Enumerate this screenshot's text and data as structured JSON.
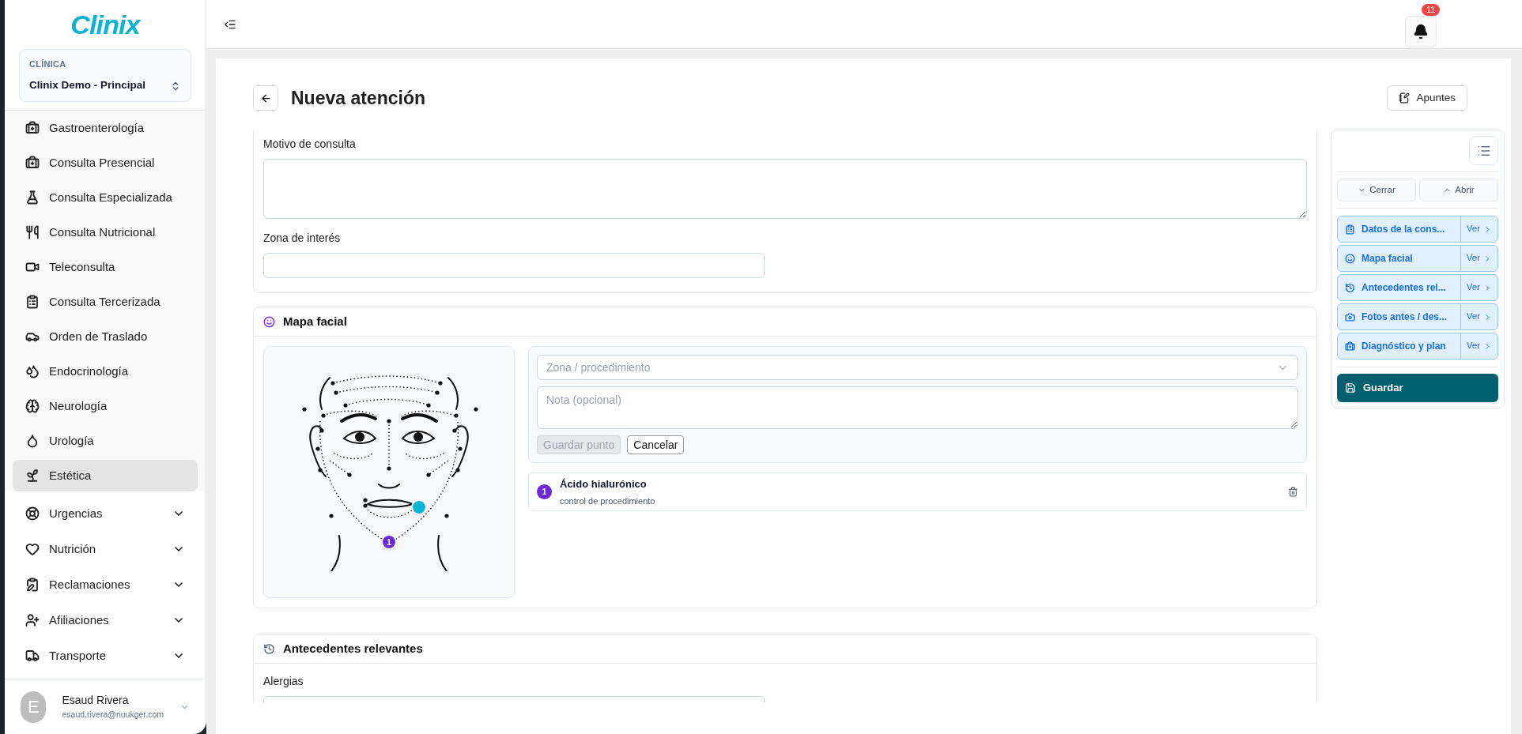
{
  "brand": {
    "logo": "Clinix"
  },
  "clinic": {
    "label": "CLÍNICA",
    "value": "Clinix Demo - Principal"
  },
  "sidebar": {
    "items": [
      {
        "kind": "link",
        "label": "Gastroenterología",
        "selected": false
      },
      {
        "kind": "link",
        "label": "Consulta Presencial",
        "selected": false
      },
      {
        "kind": "link",
        "label": "Consulta Especializada",
        "selected": false
      },
      {
        "kind": "link",
        "label": "Consulta Nutricional",
        "selected": false
      },
      {
        "kind": "link",
        "label": "Teleconsulta",
        "selected": false
      },
      {
        "kind": "link",
        "label": "Consulta Tercerizada",
        "selected": false
      },
      {
        "kind": "link",
        "label": "Orden de Traslado",
        "selected": false
      },
      {
        "kind": "link",
        "label": "Endocrinología",
        "selected": false
      },
      {
        "kind": "link",
        "label": "Neurología",
        "selected": false
      },
      {
        "kind": "link",
        "label": "Urología",
        "selected": false
      },
      {
        "kind": "link",
        "label": "Estética",
        "selected": true
      },
      {
        "kind": "group",
        "label": "Urgencias",
        "selected": false,
        "expanded": false
      },
      {
        "kind": "group",
        "label": "Nutrición",
        "selected": false,
        "expanded": false
      },
      {
        "kind": "group",
        "label": "Reclamaciones",
        "selected": false,
        "expanded": false
      },
      {
        "kind": "group",
        "label": "Afiliaciones",
        "selected": false,
        "expanded": false
      },
      {
        "kind": "group",
        "label": "Transporte",
        "selected": false,
        "expanded": false
      }
    ]
  },
  "user": {
    "initial": "E",
    "name": "Esaud Rivera",
    "email": "esaud.rivera@nuukger.com"
  },
  "header": {
    "notification_count": "11"
  },
  "page": {
    "title": "Nueva atención",
    "notes_button": "Apuntes"
  },
  "consultation": {
    "reason_label": "Motivo de consulta",
    "zone_label": "Zona de interés"
  },
  "facial_map": {
    "title": "Mapa facial",
    "markers": [
      {
        "kind": "pending"
      },
      {
        "kind": "point",
        "label": "1"
      }
    ],
    "zone_select": {
      "placeholder": "Zona / procedimiento"
    },
    "note": {
      "placeholder": "Nota (opcional)"
    },
    "save_button": {
      "label": "Guardar punto",
      "disabled": true
    },
    "cancel_button": "Cancelar",
    "points": [
      {
        "number": "1",
        "title": "Ácido hialurónico",
        "note": "control de procedimiento"
      }
    ]
  },
  "history": {
    "title": "Antecedentes relevantes",
    "allergies_label": "Alergias"
  },
  "outline": {
    "collapse": "Cerrar",
    "expand": "Abrir",
    "items": [
      {
        "label": "Datos de la cons...",
        "action": "Ver"
      },
      {
        "label": "Mapa facial",
        "action": "Ver"
      },
      {
        "label": "Antecedentes rel...",
        "action": "Ver"
      },
      {
        "label": "Fotos antes / des...",
        "action": "Ver"
      },
      {
        "label": "Diagnóstico y plan",
        "action": "Ver"
      }
    ],
    "save": "Guardar"
  }
}
